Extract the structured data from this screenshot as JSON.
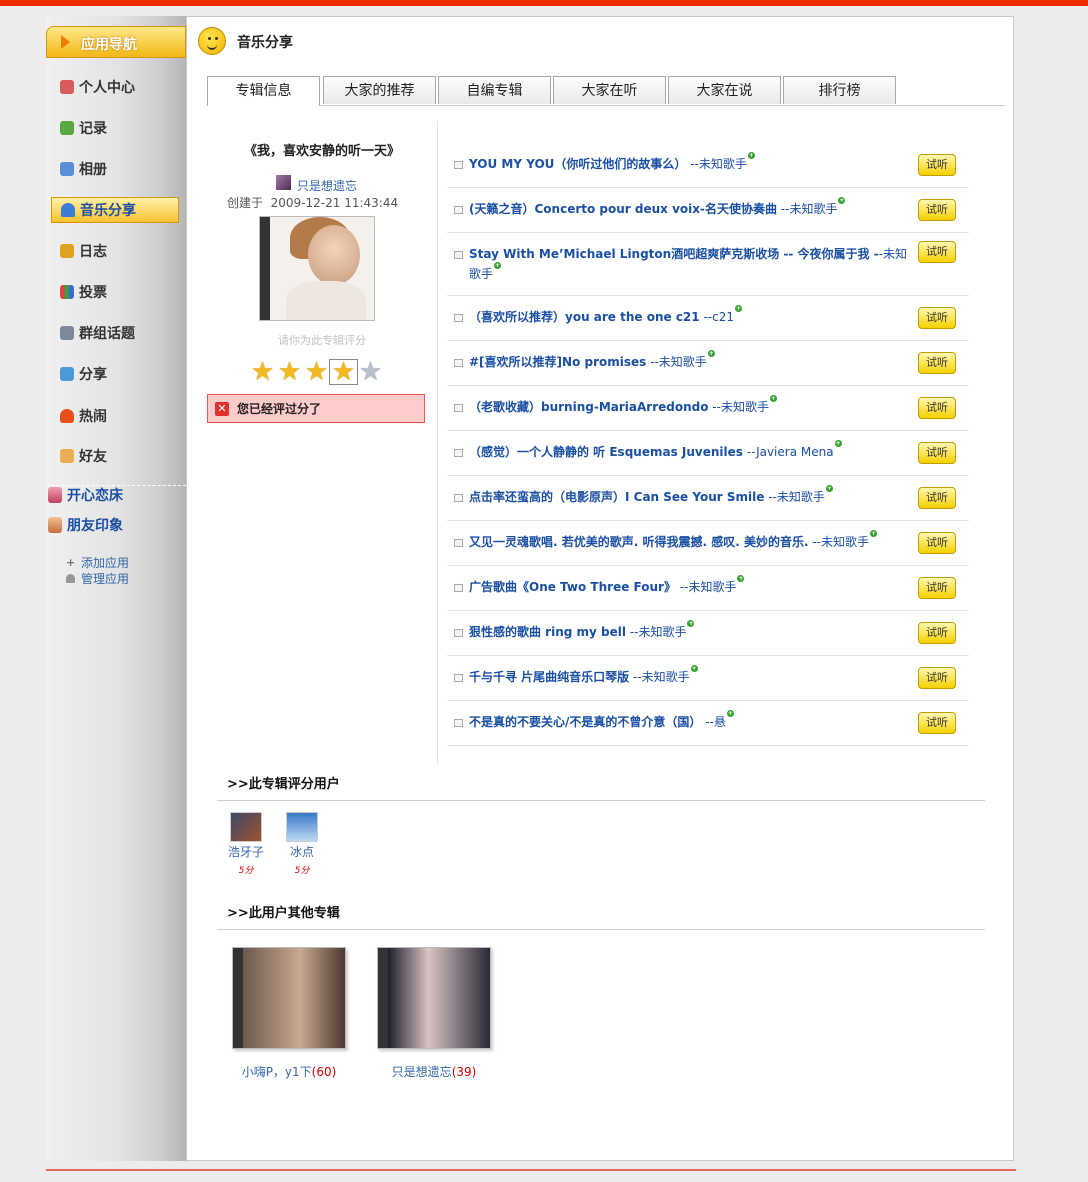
{
  "sidebar": {
    "header": "应用导航",
    "items": [
      {
        "label": "个人中心",
        "icon": "person-home-icon",
        "color": "#d85a5a"
      },
      {
        "label": "记录",
        "icon": "pencil-icon",
        "color": "#5aa845"
      },
      {
        "label": "相册",
        "icon": "photo-album-icon",
        "color": "#5a8fd8"
      },
      {
        "label": "音乐分享",
        "icon": "headphones-icon",
        "color": "#3a7bd5"
      },
      {
        "label": "日志",
        "icon": "journal-icon",
        "color": "#e0a020"
      },
      {
        "label": "投票",
        "icon": "bar-chart-icon",
        "color": "#e04040"
      },
      {
        "label": "群组话题",
        "icon": "group-topic-icon",
        "color": "#7a8a9a"
      },
      {
        "label": "分享",
        "icon": "share-icon",
        "color": "#4a9ad8"
      },
      {
        "label": "热闹",
        "icon": "fire-icon",
        "color": "#e8501a"
      },
      {
        "label": "好友",
        "icon": "handshake-icon",
        "color": "#e8b050"
      }
    ],
    "apps": [
      {
        "label": "开心恋床",
        "icon": "love-bed-icon"
      },
      {
        "label": "朋友印象",
        "icon": "friend-impression-icon"
      }
    ],
    "links": [
      {
        "label": "添加应用",
        "icon": "plus-icon"
      },
      {
        "label": "管理应用",
        "icon": "wrench-icon"
      }
    ]
  },
  "page_title": "音乐分享",
  "tabs": [
    "专辑信息",
    "大家的推荐",
    "自编专辑",
    "大家在听",
    "大家在说",
    "排行榜"
  ],
  "album": {
    "title": "《我，喜欢安静的听一天》",
    "creator": "只是想遗忘",
    "created_label": "创建于",
    "created_at": "2009-12-21 11:43:44",
    "rate_hint": "请你为此专辑评分",
    "rating": 4,
    "rating_max": 5,
    "rated_message": "您已经评过分了"
  },
  "songs": [
    {
      "title": "YOU MY YOU（你听过他们的故事么）",
      "artist": " --未知歌手"
    },
    {
      "title": "(天籁之音）Concerto pour deux voix-名天使协奏曲",
      "artist": " --未知歌手"
    },
    {
      "title": "Stay With Me’Michael Lington酒吧超爽萨克斯收场 -- 今夜你属于我 -",
      "artist": "-未知歌手"
    },
    {
      "title": "（喜欢所以推荐）you are the one c21",
      "artist": " --c21"
    },
    {
      "title": "#[喜欢所以推荐]No promises",
      "artist": " --未知歌手"
    },
    {
      "title": "（老歌收藏）burning-MariaArredondo",
      "artist": " --未知歌手"
    },
    {
      "title": "（感觉）一个人静静的 听 Esquemas Juveniles",
      "artist": " --Javiera Mena"
    },
    {
      "title": "点击率还蛮高的（电影原声）I Can See Your Smile",
      "artist": " --未知歌手"
    },
    {
      "title": "又见一灵魂歌唱. 若优美的歌声. 听得我震撼. 感叹. 美妙的音乐.",
      "artist": " --未知歌手"
    },
    {
      "title": "广告歌曲《One Two Three Four》",
      "artist": " --未知歌手"
    },
    {
      "title": "狠性感的歌曲 ring my bell",
      "artist": " --未知歌手"
    },
    {
      "title": "千与千寻 片尾曲纯音乐口琴版",
      "artist": " --未知歌手"
    },
    {
      "title": "不是真的不要关心/不是真的不曾介意（国）",
      "artist": " --悬"
    }
  ],
  "listen_label": "试听",
  "raters_section": {
    "title": ">>此专辑评分用户",
    "users": [
      {
        "name": "浩牙子",
        "score": "5分"
      },
      {
        "name": "冰点",
        "score": "5分"
      }
    ]
  },
  "other_albums_section": {
    "title": ">>此用户其他专辑",
    "albums": [
      {
        "name": "小嗨P，y1下",
        "count": "(60)"
      },
      {
        "name": "只是想遗忘",
        "count": "(39)"
      }
    ]
  },
  "colors": {
    "top_bar": "#ee2a00",
    "link_blue": "#1a4fa3",
    "accent_yellow": "#f3b715",
    "error_red": "#e05555"
  }
}
